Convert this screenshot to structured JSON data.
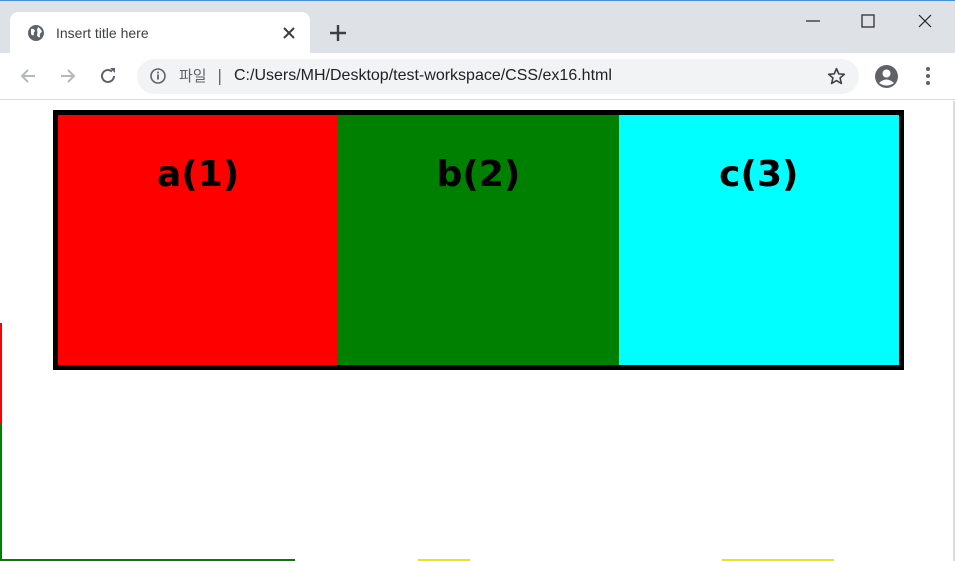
{
  "browser": {
    "tab": {
      "title": "Insert title here",
      "favicon": "globe-icon",
      "close_icon": "close-icon"
    },
    "new_tab_icon": "plus-icon",
    "window_controls": [
      "minimize-icon",
      "maximize-icon",
      "close-icon"
    ],
    "toolbar": {
      "back_icon": "arrow-left-icon",
      "forward_icon": "arrow-right-icon",
      "reload_icon": "reload-icon",
      "address": {
        "info_icon": "info-icon",
        "scheme_label": "파일",
        "separator": "|",
        "url": "C:/Users/MH/Desktop/test-workspace/CSS/ex16.html"
      },
      "bookmark_icon": "star-icon",
      "profile_icon": "account-icon",
      "menu_icon": "kebab-menu-icon"
    }
  },
  "page": {
    "boxes": [
      {
        "label": "a(1)",
        "color": "#ff0000"
      },
      {
        "label": "b(2)",
        "color": "#008000"
      },
      {
        "label": "c(3)",
        "color": "#00ffff"
      }
    ],
    "container_border_color": "#000000"
  }
}
